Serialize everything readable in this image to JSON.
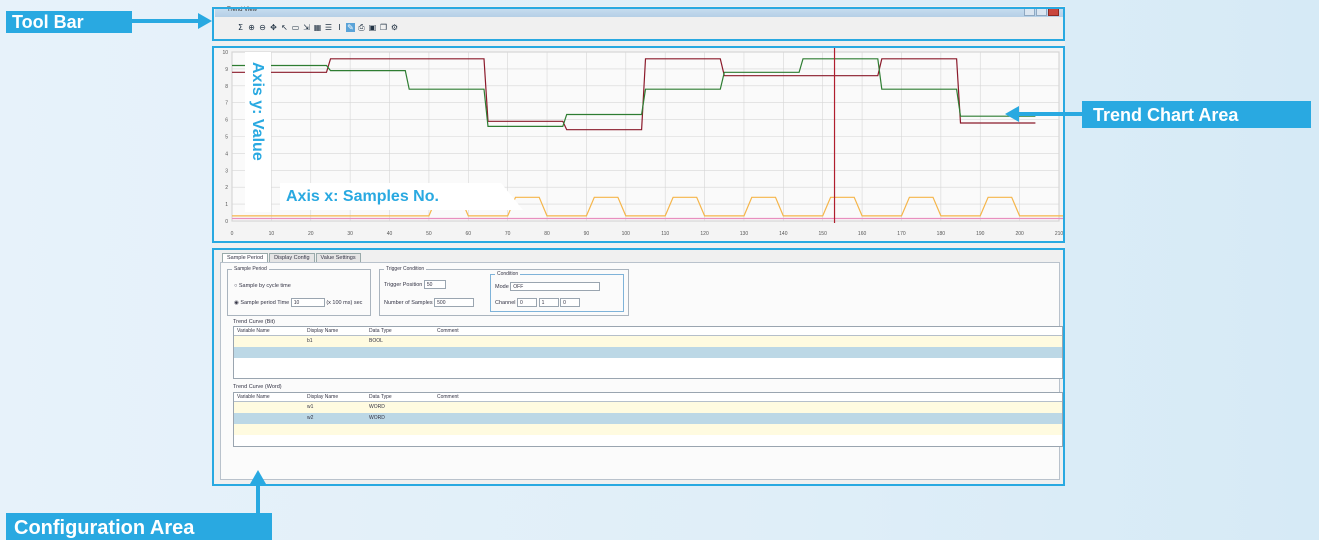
{
  "annotations": {
    "toolbar": "Tool Bar",
    "trend_chart": "Trend Chart Area",
    "configuration": "Configuration Area",
    "axis_y": "Axis y: Value",
    "axis_x": "Axis x: Samples No."
  },
  "accent_color": "#29a9e1",
  "window": {
    "title": "Trend View"
  },
  "toolbar": {
    "buttons": [
      "sigma-icon",
      "zoom-in-icon",
      "zoom-out-icon",
      "pan-icon",
      "cursor-icon",
      "fit-icon",
      "export-icon",
      "grid-icon",
      "legend-icon",
      "marker-icon",
      "pen-icon",
      "print-icon",
      "save-icon",
      "copy-icon",
      "settings-icon"
    ]
  },
  "chart_data": {
    "type": "line",
    "x_ticks": [
      "0",
      "10",
      "20",
      "30",
      "40",
      "50",
      "60",
      "70",
      "80",
      "90",
      "100",
      "110",
      "120",
      "130",
      "140",
      "150",
      "160",
      "170",
      "180",
      "190",
      "200",
      "210"
    ],
    "y_ticks": [
      "0",
      "1",
      "2",
      "3",
      "4",
      "5",
      "6",
      "7",
      "8",
      "9",
      "10"
    ],
    "xlim": [
      0,
      210
    ],
    "ylim": [
      0,
      10
    ],
    "grid": true,
    "cursor_x": 153,
    "series": [
      {
        "color": "#8b1a2b",
        "x": [
          0,
          24,
          25,
          44,
          45,
          64,
          65,
          84,
          85,
          104,
          105,
          124,
          125,
          144,
          145,
          164,
          165,
          184,
          185,
          204
        ],
        "y": [
          8.8,
          8.8,
          9.6,
          9.6,
          9.6,
          9.6,
          5.9,
          5.9,
          5.4,
          5.4,
          9.6,
          9.6,
          8.6,
          8.6,
          8.6,
          8.6,
          9.6,
          9.6,
          5.8,
          5.8
        ]
      },
      {
        "color": "#2e7d32",
        "x": [
          0,
          24,
          25,
          44,
          45,
          64,
          65,
          84,
          85,
          104,
          105,
          124,
          125,
          144,
          145,
          164,
          165,
          184,
          185,
          204
        ],
        "y": [
          9.2,
          9.2,
          8.9,
          8.9,
          7.8,
          7.8,
          5.6,
          5.6,
          6.3,
          6.3,
          7.8,
          7.8,
          8.8,
          8.8,
          9.6,
          9.6,
          7.8,
          7.8,
          6.2,
          6.2
        ]
      },
      {
        "color": "#f5b54a",
        "x": [
          0,
          50,
          52,
          58,
          60,
          70,
          72,
          78,
          80,
          90,
          92,
          98,
          100,
          110,
          112,
          118,
          120,
          130,
          132,
          138,
          140,
          150,
          152,
          158,
          160,
          170,
          172,
          178,
          180,
          190,
          192,
          198,
          200,
          215
        ],
        "y": [
          0.3,
          0.3,
          1.4,
          1.4,
          0.3,
          0.3,
          1.4,
          1.4,
          0.3,
          0.3,
          1.4,
          1.4,
          0.3,
          0.3,
          1.4,
          1.4,
          0.3,
          0.3,
          1.4,
          1.4,
          0.3,
          0.3,
          1.4,
          1.4,
          0.3,
          0.3,
          1.4,
          1.4,
          0.3,
          0.3,
          1.4,
          1.4,
          0.3,
          0.3
        ]
      },
      {
        "color": "#e88fbf",
        "x": [
          0,
          215
        ],
        "y": [
          0.15,
          0.15
        ]
      }
    ]
  },
  "config": {
    "tabs": [
      "Sample Period",
      "Display Config",
      "Value Settings"
    ],
    "sample_period": {
      "title": "Sample Period",
      "option1": "Sample by cycle time",
      "option2": "Sample period Time",
      "period_value": "10",
      "period_unit": "(x 100 ms) sec"
    },
    "trigger": {
      "title": "Trigger Condition",
      "source_label": "Trigger Position",
      "source_value": "50",
      "samples_label": "Number of Samples",
      "samples_value": "500",
      "inner_title": "Condition",
      "mode_label": "Mode",
      "mode_value": "OFF",
      "channel_label": "Channel",
      "ch_val1": "0",
      "ch_val2": "1",
      "ch_val3": "0"
    },
    "grid1": {
      "title": "Trend Curve (Bit)",
      "headers": [
        "Variable Name",
        "Display Name",
        "Data Type",
        "Comment"
      ],
      "rows": [
        {
          "c1": "",
          "c2": "b1",
          "c3": "BOOL",
          "c4": ""
        },
        {
          "c1": "",
          "c2": "",
          "c3": "",
          "c4": ""
        }
      ]
    },
    "grid2": {
      "title": "Trend Curve (Word)",
      "headers": [
        "Variable Name",
        "Display Name",
        "Data Type",
        "Comment"
      ],
      "rows": [
        {
          "c1": "",
          "c2": "w1",
          "c3": "WORD",
          "c4": ""
        },
        {
          "c1": "",
          "c2": "w2",
          "c3": "WORD",
          "c4": ""
        },
        {
          "c1": "",
          "c2": "",
          "c3": "",
          "c4": ""
        }
      ]
    }
  }
}
